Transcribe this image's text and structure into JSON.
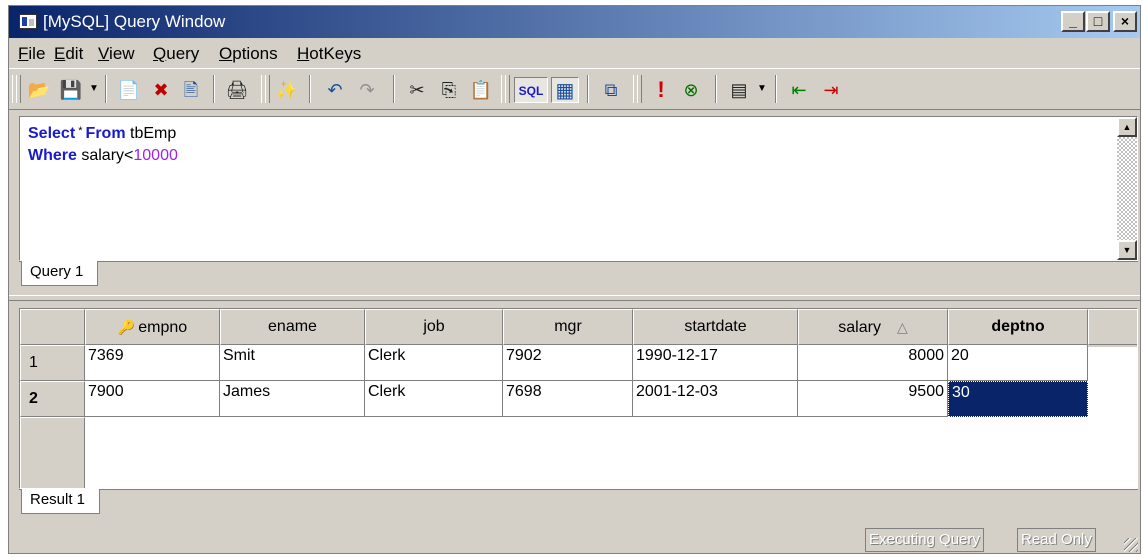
{
  "window": {
    "title": "[MySQL] Query Window",
    "minimize": "_",
    "maximize": "□",
    "close": "×"
  },
  "menu": [
    "File",
    "Edit",
    "View",
    "Query",
    "Options",
    "HotKeys"
  ],
  "toolbar_icons": {
    "open": "📂",
    "save": "💾",
    "new_query": "📄",
    "delete": "✖",
    "refresh": "🖹",
    "print": "🖨",
    "magic": "✨",
    "undo": "↶",
    "redo": "↷",
    "cut": "✂",
    "copy": "⎘",
    "paste": "📋",
    "sql": "SQL",
    "grid": "▦",
    "results": "⧉",
    "execute": "!",
    "cancel": "⊗",
    "layout": "▤",
    "export_in": "⇤",
    "export_out": "⇥",
    "dropdown": "▼"
  },
  "query": {
    "line1": {
      "kw1": "Select",
      "star": " * ",
      "kw2": "From",
      "rest": " tbEmp"
    },
    "line2": {
      "kw": "Where",
      "rest": " salary<",
      "num": "10000"
    },
    "tab": "Query 1",
    "scroll_up": "▲",
    "scroll_down": "▼"
  },
  "result": {
    "tab": "Result 1",
    "key_icon": "🔑",
    "sort_icon": "△",
    "columns": [
      "empno",
      "ename",
      "job",
      "mgr",
      "startdate",
      "salary",
      "deptno"
    ],
    "rows": [
      {
        "num": "1",
        "cells": [
          "7369",
          "Smit",
          "Clerk",
          "7902",
          "1990-12-17",
          "8000",
          "20"
        ]
      },
      {
        "num": "2",
        "cells": [
          "7900",
          "James",
          "Clerk",
          "7698",
          "2001-12-03",
          "9500",
          "30"
        ]
      }
    ]
  },
  "status": {
    "executing": "Executing Query",
    "readonly": "Read Only"
  }
}
